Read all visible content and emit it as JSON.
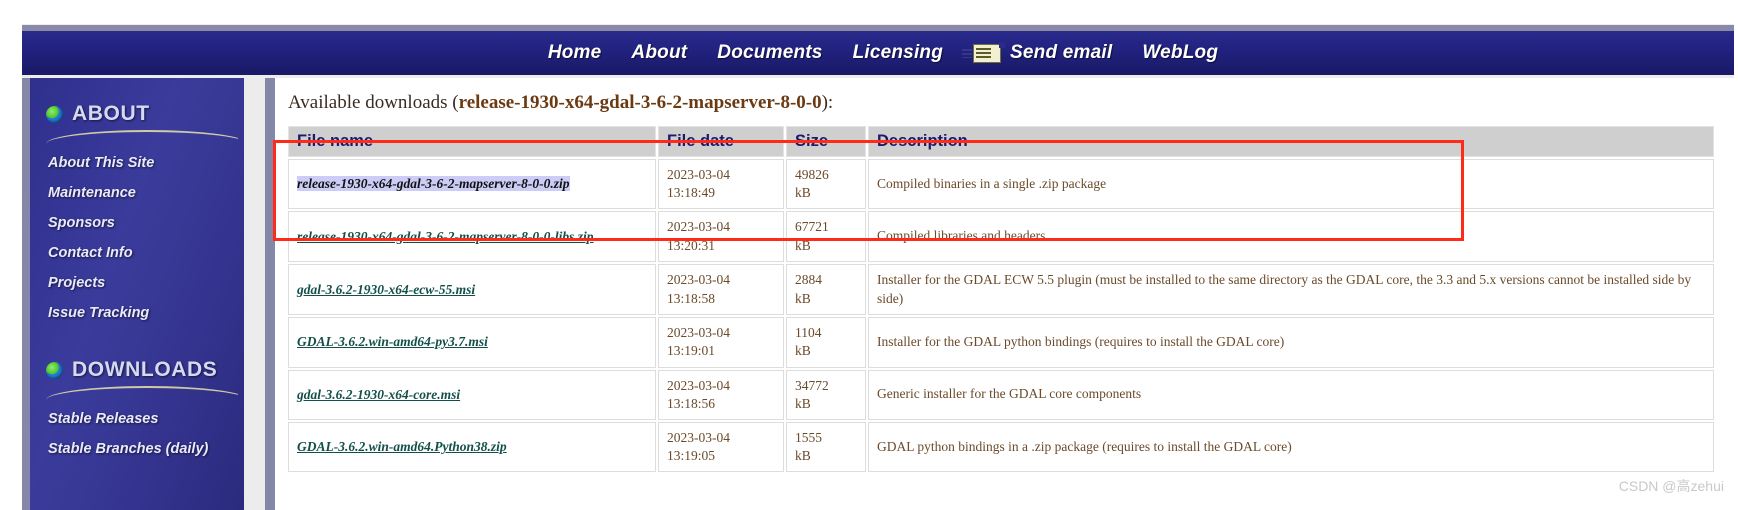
{
  "nav": {
    "items": [
      {
        "label": "Home",
        "icon": null
      },
      {
        "label": "About",
        "icon": null
      },
      {
        "label": "Documents",
        "icon": null
      },
      {
        "label": "Licensing",
        "icon": null
      },
      {
        "label": "Send email",
        "icon": "envelope-icon"
      },
      {
        "label": "WebLog",
        "icon": null
      }
    ]
  },
  "sidebar": {
    "groups": [
      {
        "title": "ABOUT",
        "icon": "globe-icon",
        "links": [
          {
            "label": "About This Site"
          },
          {
            "label": "Maintenance"
          },
          {
            "label": "Sponsors"
          },
          {
            "label": "Contact Info"
          },
          {
            "label": "Projects"
          },
          {
            "label": "Issue Tracking"
          }
        ]
      },
      {
        "title": "DOWNLOADS",
        "icon": "globe-icon",
        "links": [
          {
            "label": "Stable Releases"
          },
          {
            "label": "Stable Branches (daily)"
          }
        ]
      }
    ]
  },
  "main": {
    "heading_prefix": "Available downloads (",
    "heading_package": "release-1930-x64-gdal-3-6-2-mapserver-8-0-0",
    "heading_suffix": "):",
    "table": {
      "headers": [
        "File name",
        "File date",
        "Size",
        "Description"
      ],
      "rows": [
        {
          "name": "release-1930-x64-gdal-3-6-2-mapserver-8-0-0.zip",
          "date": "2023-03-04\n13:18:49",
          "size": "49826\nkB",
          "description": "Compiled binaries in a single .zip package",
          "selected": true
        },
        {
          "name": "release-1930-x64-gdal-3-6-2-mapserver-8-0-0-libs.zip",
          "date": "2023-03-04\n13:20:31",
          "size": "67721\nkB",
          "description": "Compiled libraries and headers",
          "selected": false
        },
        {
          "name": "gdal-3.6.2-1930-x64-ecw-55.msi",
          "date": "2023-03-04\n13:18:58",
          "size": "2884\nkB",
          "description": "Installer for the GDAL ECW 5.5 plugin (must be installed to the same directory as the GDAL core, the 3.3 and 5.x versions cannot be installed side by side)",
          "selected": false
        },
        {
          "name": "GDAL-3.6.2.win-amd64-py3.7.msi",
          "date": "2023-03-04\n13:19:01",
          "size": "1104\nkB",
          "description": "Installer for the GDAL python bindings (requires to install the GDAL core)",
          "selected": false
        },
        {
          "name": "gdal-3.6.2-1930-x64-core.msi",
          "date": "2023-03-04\n13:18:56",
          "size": "34772\nkB",
          "description": "Generic installer for the GDAL core components",
          "selected": false
        },
        {
          "name": "GDAL-3.6.2.win-amd64.Python38.zip",
          "date": "2023-03-04\n13:19:05",
          "size": "1555\nkB",
          "description": "GDAL python bindings in a .zip package (requires to install the GDAL core)",
          "selected": false
        }
      ]
    }
  },
  "watermark": {
    "text": "CSDN @高zehui"
  },
  "colors": {
    "nav_bg": "#21217f",
    "sidebar_bg": "#3b3b9c",
    "header_text": "#1b1b6e",
    "link": "#134f4a",
    "body_text": "#7a4a20",
    "annotation": "#ff2a17",
    "selection": "#ccccf7"
  }
}
